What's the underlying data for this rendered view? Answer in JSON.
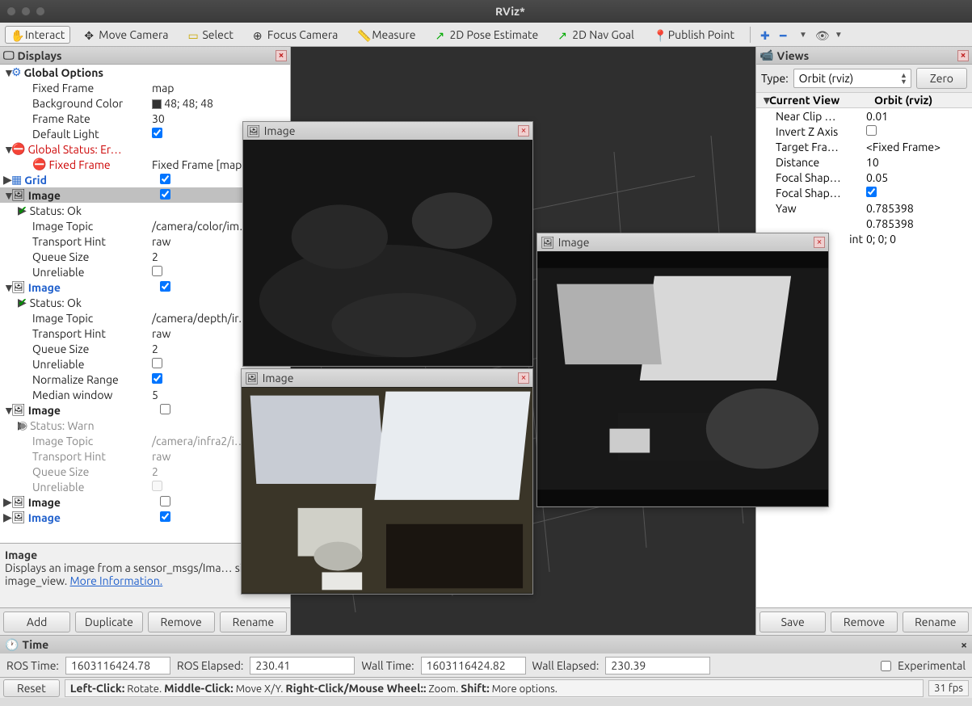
{
  "window": {
    "title": "RViz*"
  },
  "toolbar": {
    "interact": "Interact",
    "move_camera": "Move Camera",
    "select": "Select",
    "focus_camera": "Focus Camera",
    "measure": "Measure",
    "pose_estimate": "2D Pose Estimate",
    "nav_goal": "2D Nav Goal",
    "publish_point": "Publish Point"
  },
  "displays": {
    "title": "Displays",
    "global_options": {
      "label": "Global Options",
      "fixed_frame_l": "Fixed Frame",
      "fixed_frame_v": "map",
      "bg_color_l": "Background Color",
      "bg_color_v": "48; 48; 48",
      "frame_rate_l": "Frame Rate",
      "frame_rate_v": "30",
      "default_light_l": "Default Light"
    },
    "global_status": {
      "label": "Global Status: Er…",
      "fixed_frame_l": "Fixed Frame",
      "fixed_frame_v": "Fixed Frame [map…"
    },
    "grid_label": "Grid",
    "image1": {
      "label": "Image",
      "status": "Status: Ok",
      "topic_l": "Image Topic",
      "topic_v": "/camera/color/im…",
      "hint_l": "Transport Hint",
      "hint_v": "raw",
      "queue_l": "Queue Size",
      "queue_v": "2",
      "unrel_l": "Unreliable"
    },
    "image2": {
      "label": "Image",
      "status": "Status: Ok",
      "topic_l": "Image Topic",
      "topic_v": "/camera/depth/ir…",
      "hint_l": "Transport Hint",
      "hint_v": "raw",
      "queue_l": "Queue Size",
      "queue_v": "2",
      "unrel_l": "Unreliable",
      "norm_l": "Normalize Range",
      "median_l": "Median window",
      "median_v": "5"
    },
    "image3": {
      "label": "Image",
      "status": "Status: Warn",
      "topic_l": "Image Topic",
      "topic_v": "/camera/infra2/i…",
      "hint_l": "Transport Hint",
      "hint_v": "raw",
      "queue_l": "Queue Size",
      "queue_v": "2",
      "unrel_l": "Unreliable"
    },
    "image4_label": "Image",
    "image5_label": "Image",
    "desc_title": "Image",
    "desc_body": "Displays an image from a sensor_msgs/Ima… similar to image_view. ",
    "desc_link": "More Information.",
    "btn_add": "Add",
    "btn_dup": "Duplicate",
    "btn_rem": "Remove",
    "btn_ren": "Rename"
  },
  "views": {
    "title": "Views",
    "type_label": "Type:",
    "type_value": "Orbit (rviz)",
    "zero": "Zero",
    "header_l": "Current View",
    "header_r": "Orbit (rviz)",
    "rows": [
      {
        "l": "Near Clip …",
        "r": "0.01"
      },
      {
        "l": "Invert Z Axis",
        "r": "",
        "chk": true
      },
      {
        "l": "Target Fra…",
        "r": "<Fixed Frame>"
      },
      {
        "l": "Distance",
        "r": "10"
      },
      {
        "l": "Focal Shap…",
        "r": "0.05"
      },
      {
        "l": "Focal Shap…",
        "r": "",
        "chk2": true
      },
      {
        "l": "Yaw",
        "r": "0.785398"
      },
      {
        "l": "",
        "r": "0.785398"
      },
      {
        "l": "int",
        "r": "0; 0; 0"
      }
    ],
    "btn_save": "Save",
    "btn_rem": "Remove",
    "btn_ren": "Rename"
  },
  "imgwins": {
    "title": "Image"
  },
  "time": {
    "title": "Time",
    "ros_time_l": "ROS Time:",
    "ros_time_v": "1603116424.78",
    "ros_elapsed_l": "ROS Elapsed:",
    "ros_elapsed_v": "230.41",
    "wall_time_l": "Wall Time:",
    "wall_time_v": "1603116424.82",
    "wall_elapsed_l": "Wall Elapsed:",
    "wall_elapsed_v": "230.39",
    "experimental": "Experimental"
  },
  "status": {
    "reset": "Reset",
    "hint": "Left-Click: Rotate. Middle-Click: Move X/Y. Right-Click/Mouse Wheel:: Zoom. Shift: More options.",
    "fps": "31 fps"
  }
}
